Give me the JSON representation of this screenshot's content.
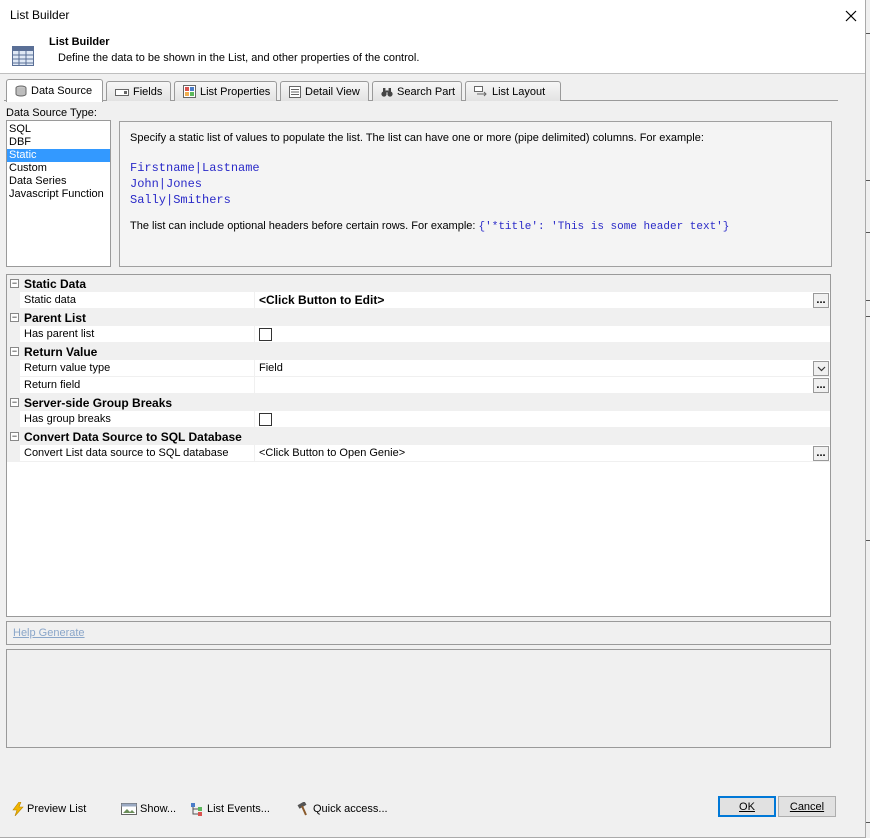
{
  "window": {
    "title": "List Builder",
    "close_glyph": "✕"
  },
  "header": {
    "title": "List Builder",
    "subtitle": "Define the data to be shown in the List, and other properties of the control.",
    "icon": "list-grid-icon"
  },
  "tabs": [
    {
      "label": "Data Source",
      "icon": "database-icon",
      "active": true
    },
    {
      "label": "Fields",
      "icon": "fields-icon",
      "active": false
    },
    {
      "label": "List Properties",
      "icon": "list-properties-icon",
      "active": false
    },
    {
      "label": "Detail View",
      "icon": "detail-view-icon",
      "active": false
    },
    {
      "label": "Search Part",
      "icon": "binoculars-icon",
      "active": false
    },
    {
      "label": "List Layout",
      "icon": "list-layout-icon",
      "active": false
    }
  ],
  "data_source": {
    "label": "Data Source Type:",
    "items": [
      "SQL",
      "DBF",
      "Static",
      "Custom",
      "Data Series",
      "Javascript Function"
    ],
    "selected": "Static"
  },
  "info": {
    "line1": "Specify a static list of values to populate the list. The list can have one or more (pipe delimited) columns. For example:",
    "example": [
      "Firstname|Lastname",
      "John|Jones",
      "Sally|Smithers"
    ],
    "line2": "The list can include optional headers before certain rows. For example:",
    "header_example": "{'*title': 'This is some header text'}"
  },
  "grid": {
    "categories": [
      {
        "title": "Static Data",
        "toggle": "−",
        "props": [
          {
            "name": "Static data",
            "value": "<Click Button to Edit>",
            "bold": true,
            "control": "ellipsis"
          }
        ]
      },
      {
        "title": "Parent List",
        "toggle": "−",
        "props": [
          {
            "name": "Has parent list",
            "value": "",
            "control": "checkbox"
          }
        ]
      },
      {
        "title": "Return Value",
        "toggle": "−",
        "props": [
          {
            "name": "Return value type",
            "value": "Field",
            "control": "dropdown"
          },
          {
            "name": "Return field",
            "value": "",
            "control": "ellipsis"
          }
        ]
      },
      {
        "title": "Server-side Group Breaks",
        "toggle": "−",
        "props": [
          {
            "name": "Has group breaks",
            "value": "",
            "control": "checkbox"
          }
        ]
      },
      {
        "title": "Convert Data Source to SQL Database",
        "toggle": "−",
        "props": [
          {
            "name": "Convert List data source to SQL database",
            "value": "<Click Button to Open Genie>",
            "control": "ellipsis"
          }
        ]
      }
    ],
    "ellipsis": "..."
  },
  "help": {
    "link": "Help Generate"
  },
  "footer": {
    "preview": "Preview List",
    "show": "Show...",
    "events": "List Events...",
    "quick": "Quick access...",
    "ok": "OK",
    "cancel": "Cancel"
  },
  "colors": {
    "selection": "#3399ff",
    "code": "#2a2ac8",
    "link_disabled": "#8aa6c9",
    "default_button_border": "#0078d7"
  }
}
